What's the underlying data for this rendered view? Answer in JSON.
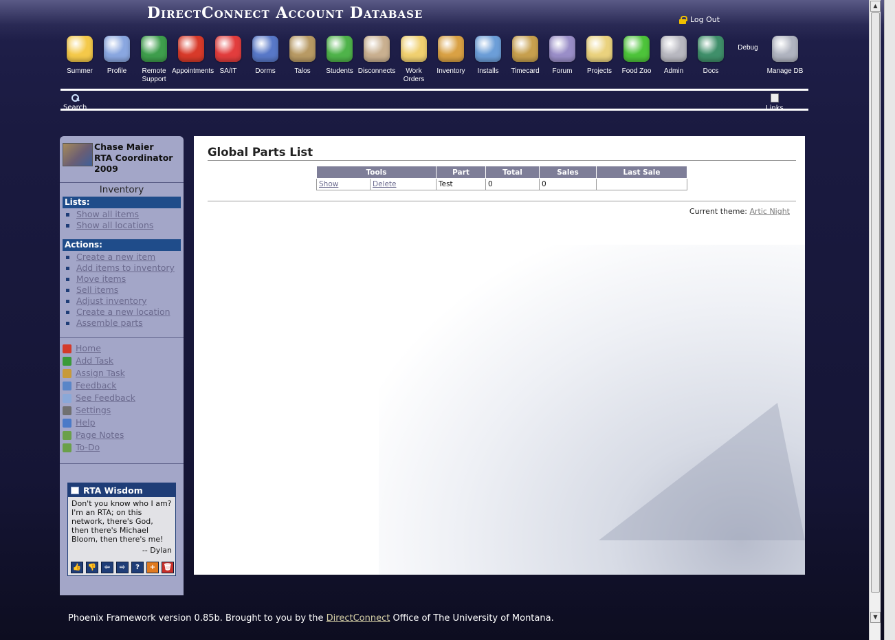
{
  "header": {
    "app_title": "DirectConnect Account Database",
    "logout_label": "Log Out"
  },
  "nav": {
    "items": [
      {
        "label": "Summer",
        "icon": "smiley-sunglasses-icon",
        "color": "#f4c94a"
      },
      {
        "label": "Profile",
        "icon": "profile-card-icon",
        "color": "#8aa7e0"
      },
      {
        "label": "Remote Support",
        "icon": "globe-question-icon",
        "color": "#3e9e4c"
      },
      {
        "label": "Appointments",
        "icon": "alarm-clock-icon",
        "color": "#d83a2a"
      },
      {
        "label": "SA/IT",
        "icon": "first-aid-icon",
        "color": "#e23d3d"
      },
      {
        "label": "Dorms",
        "icon": "building-icon",
        "color": "#5878c8"
      },
      {
        "label": "Talos",
        "icon": "helmet-icon",
        "color": "#b89a64"
      },
      {
        "label": "Students",
        "icon": "student-icon",
        "color": "#4fb34a"
      },
      {
        "label": "Disconnects",
        "icon": "unplug-icon",
        "color": "#c9b090"
      },
      {
        "label": "Work Orders",
        "icon": "work-order-icon",
        "color": "#f0d070"
      },
      {
        "label": "Inventory",
        "icon": "box-icon",
        "color": "#d9a144"
      },
      {
        "label": "Installs",
        "icon": "install-disc-icon",
        "color": "#6c9ed8"
      },
      {
        "label": "Timecard",
        "icon": "money-bag-icon",
        "color": "#c7a04e"
      },
      {
        "label": "Forum",
        "icon": "forum-bubble-icon",
        "color": "#9a8ec8"
      },
      {
        "label": "Projects",
        "icon": "folders-icon",
        "color": "#ead27e"
      },
      {
        "label": "Food Zoo",
        "icon": "apple-icon",
        "color": "#4dc43a"
      },
      {
        "label": "Admin",
        "icon": "gears-icon",
        "color": "#b8b8c0"
      },
      {
        "label": "Docs",
        "icon": "books-icon",
        "color": "#3f8f6a"
      },
      {
        "label": "Debug",
        "icon": "",
        "color": ""
      },
      {
        "label": "Manage DB",
        "icon": "database-check-icon",
        "color": "#b0b4c0"
      }
    ]
  },
  "toolbar2": {
    "search_label": "Search",
    "links_label": "Links"
  },
  "sidebar": {
    "user_name": "Chase Maier",
    "user_role": "RTA Coordinator 2009",
    "section_title": "Inventory",
    "lists_header": "Lists:",
    "lists": [
      "Show all items",
      "Show all locations"
    ],
    "actions_header": "Actions:",
    "actions": [
      "Create a new item",
      "Add items to inventory",
      "Move items",
      "Sell items",
      "Adjust inventory",
      "Create a new location",
      "Assemble parts"
    ],
    "tools": [
      {
        "label": "Home",
        "icon": "home-icon",
        "color": "#d33a2a"
      },
      {
        "label": "Add Task",
        "icon": "checkbox-icon",
        "color": "#3a9a3a"
      },
      {
        "label": "Assign Task",
        "icon": "assign-user-icon",
        "color": "#c79a3a"
      },
      {
        "label": "Feedback",
        "icon": "info-icon",
        "color": "#5a86c8"
      },
      {
        "label": "See Feedback",
        "icon": "magnify-feedback-icon",
        "color": "#8aa8d8"
      },
      {
        "label": "Settings",
        "icon": "scissors-tools-icon",
        "color": "#707070"
      },
      {
        "label": "Help",
        "icon": "help-icon",
        "color": "#4a7ac8"
      },
      {
        "label": "Page Notes",
        "icon": "note-pencil-icon",
        "color": "#6aa04a"
      },
      {
        "label": "To-Do",
        "icon": "todo-pencil-icon",
        "color": "#6aa04a"
      }
    ],
    "wisdom": {
      "title": "RTA Wisdom",
      "text": "Don't you know who I am? I'm an RTA; on this network, there's God, then there's Michael Bloom, then there's me!",
      "attribution": "-- Dylan",
      "buttons": [
        {
          "glyph": "👍",
          "icon": "thumbs-up-icon"
        },
        {
          "glyph": "👎",
          "icon": "thumbs-down-icon"
        },
        {
          "glyph": "⇦",
          "icon": "prev-icon"
        },
        {
          "glyph": "⇨",
          "icon": "next-icon"
        },
        {
          "glyph": "?",
          "icon": "question-icon"
        },
        {
          "glyph": "+",
          "icon": "add-icon"
        },
        {
          "glyph": "🗑",
          "icon": "trash-icon"
        }
      ]
    }
  },
  "main": {
    "page_title": "Global Parts List",
    "table": {
      "headers": [
        "Tools",
        "Part",
        "Total",
        "Sales",
        "Last Sale"
      ],
      "rows": [
        {
          "show": "Show",
          "delete": "Delete",
          "part": "Test",
          "total": "0",
          "sales": "0",
          "last_sale": ""
        }
      ]
    },
    "theme_label": "Current theme:",
    "theme_name": "Artic Night"
  },
  "footer": {
    "text_before": "Phoenix Framework version 0.85b. Brought to you by the ",
    "link": "DirectConnect",
    "text_after": " Office of The University of Montana."
  }
}
